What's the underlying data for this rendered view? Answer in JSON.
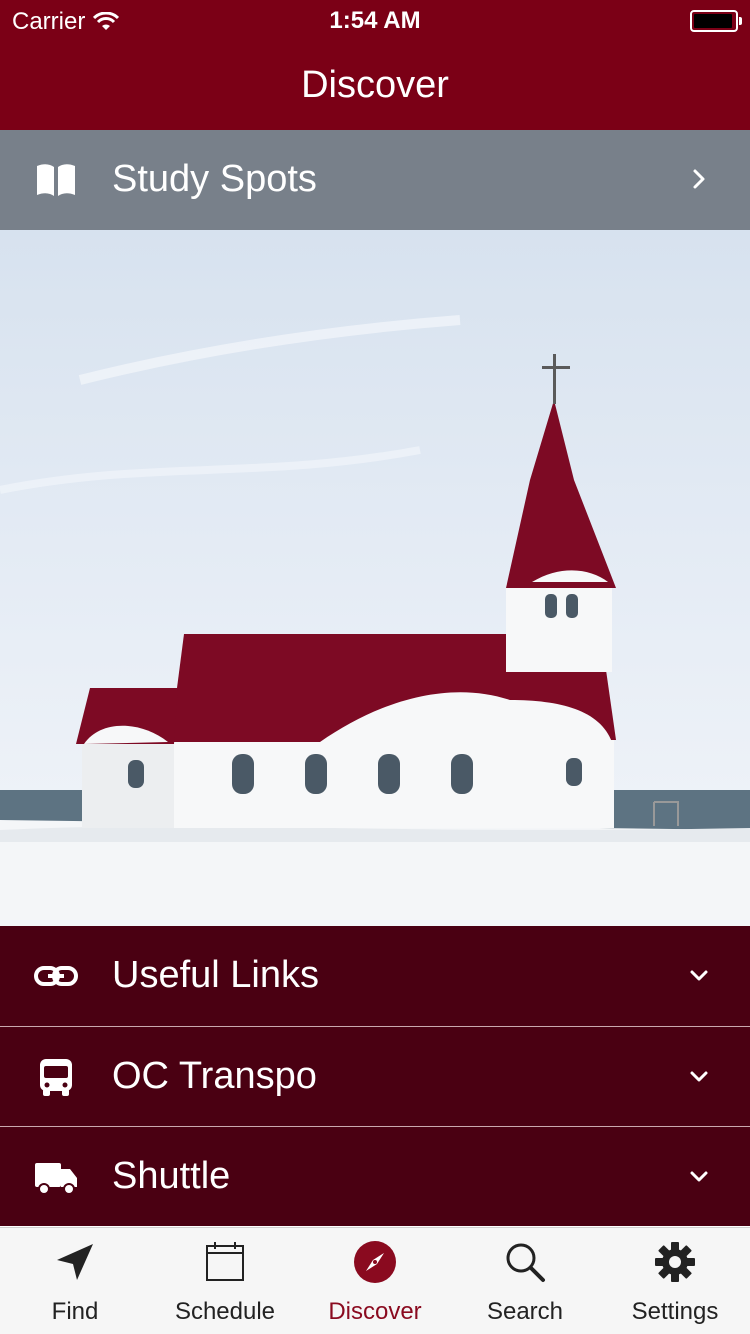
{
  "status_bar": {
    "carrier": "Carrier",
    "time": "1:54 AM"
  },
  "nav": {
    "title": "Discover"
  },
  "rows": {
    "study_spots": {
      "label": "Study Spots",
      "icon": "book-icon"
    },
    "useful_links": {
      "label": "Useful Links",
      "icon": "link-icon"
    },
    "oc_transpo": {
      "label": "OC Transpo",
      "icon": "bus-icon"
    },
    "shuttle": {
      "label": "Shuttle",
      "icon": "truck-icon"
    }
  },
  "tabs": [
    {
      "label": "Find",
      "icon": "location-arrow-icon"
    },
    {
      "label": "Schedule",
      "icon": "calendar-icon"
    },
    {
      "label": "Discover",
      "icon": "compass-icon",
      "active": true
    },
    {
      "label": "Search",
      "icon": "search-icon"
    },
    {
      "label": "Settings",
      "icon": "gear-icon"
    }
  ],
  "colors": {
    "brand": "#7b0016",
    "row_dark": "#4a0012",
    "row_gray": "#78808a",
    "tab_active": "#8a0a1f"
  }
}
